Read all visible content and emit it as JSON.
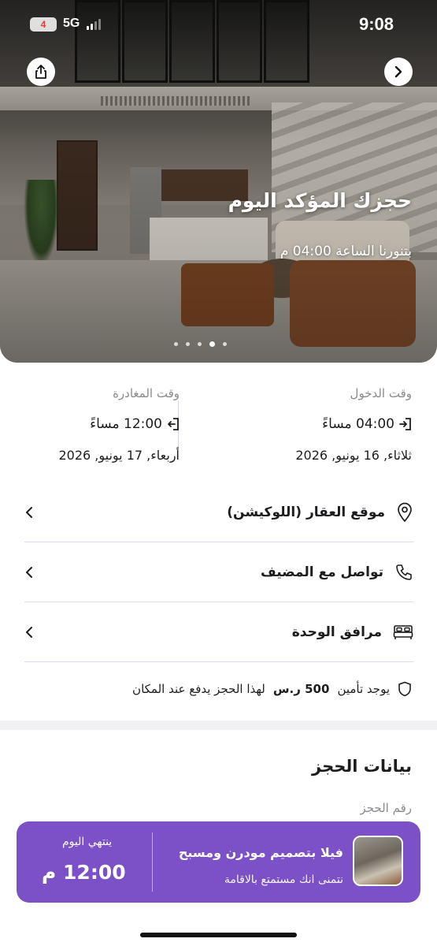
{
  "status_bar": {
    "time": "9:08",
    "battery": "4",
    "network": "5G"
  },
  "hero": {
    "title": "حجزك المؤكد اليوم",
    "subtitle": "بتنورنا الساعة 04:00 م",
    "dots_count": 5,
    "active_dot": 4
  },
  "check_in": {
    "label": "وقت الدخول",
    "time": "04:00 مساءً",
    "date": "ثلاثاء, 16 يونيو, 2026"
  },
  "check_out": {
    "label": "وقت المغادرة",
    "time": "12:00 مساءً",
    "date": "أربعاء, 17 يونيو, 2026"
  },
  "menu": [
    {
      "label": "موقع العقار (اللوكيشن)",
      "icon": "location-pin-icon"
    },
    {
      "label": "تواصل مع المضيف",
      "icon": "phone-icon"
    },
    {
      "label": "مرافق الوحدة",
      "icon": "bed-icon"
    }
  ],
  "deposit": {
    "prefix": "يوجد تأمين",
    "amount": "500 ر.س",
    "suffix": "لهذا الحجز يدفع عند المكان"
  },
  "booking": {
    "section_title": "بيانات الحجز",
    "number_label": "رقم الحجز",
    "unit_name": "فيلا بتصميم مودرن ومسبح",
    "wish": "نتمنى انك مستمتع بالاقامة",
    "ends_label": "ينتهي اليوم",
    "end_time": "12:00 م"
  },
  "colors": {
    "accent": "#7c50c6",
    "divider": "#dedbf0"
  }
}
